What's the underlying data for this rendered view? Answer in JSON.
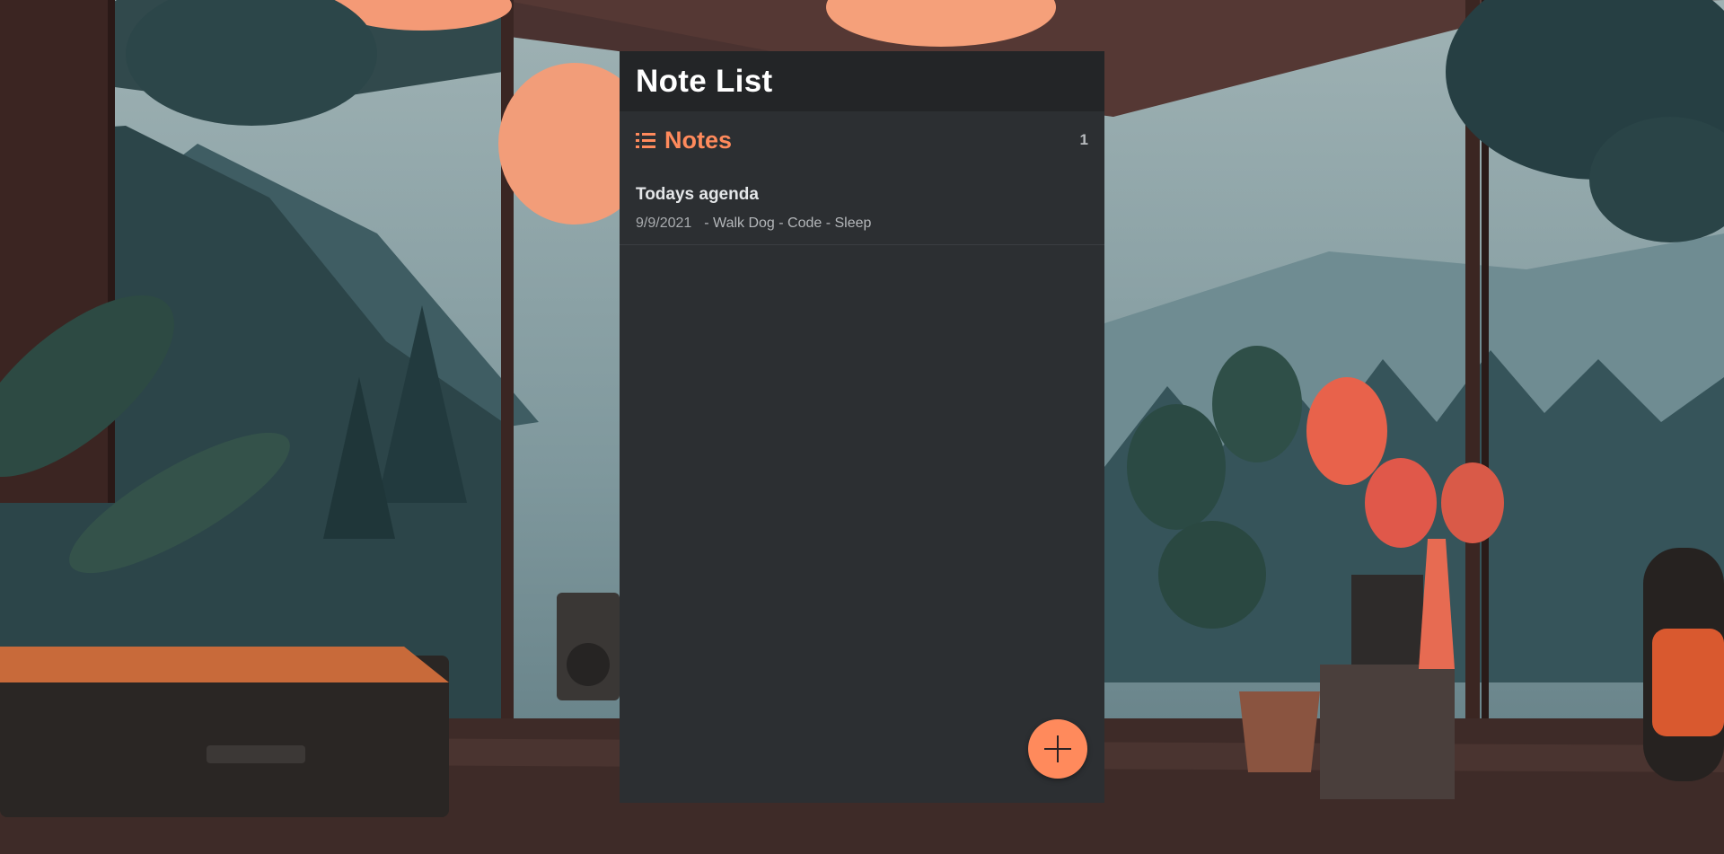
{
  "panel": {
    "title": "Note List"
  },
  "section": {
    "icon": "list-icon",
    "label": "Notes",
    "count": "1"
  },
  "notes": [
    {
      "title": "Todays agenda",
      "date": "9/9/2021",
      "preview": "- Walk Dog - Code - Sleep"
    }
  ],
  "fab": {
    "icon": "plus-icon"
  },
  "colors": {
    "accent": "#ff8a5c",
    "panel_bg": "#2c2f32",
    "header_bg": "#232527",
    "title_text": "#ffffff"
  }
}
